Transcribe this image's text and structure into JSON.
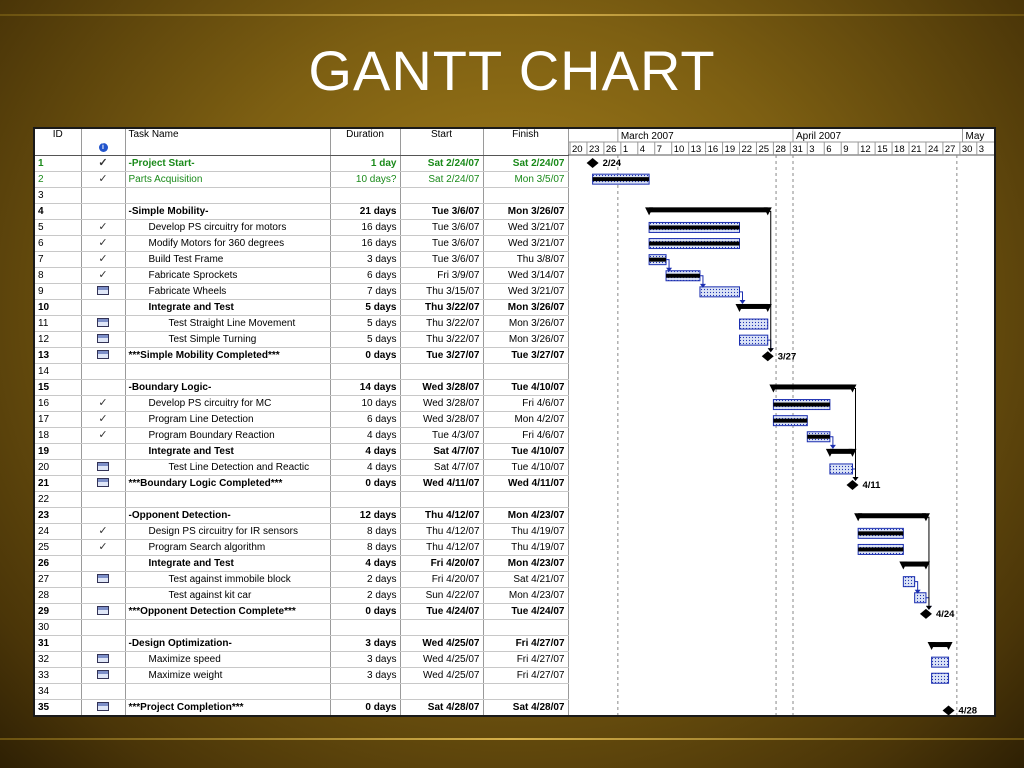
{
  "slide": {
    "title": "GANTT CHART"
  },
  "columns": {
    "id": "ID",
    "task": "Task Name",
    "duration": "Duration",
    "start": "Start",
    "finish": "Finish"
  },
  "timescale": {
    "months": [
      "March 2007",
      "April 2007",
      "May"
    ],
    "days": [
      "20",
      "23",
      "26",
      "1",
      "4",
      "7",
      "10",
      "13",
      "16",
      "19",
      "22",
      "25",
      "28",
      "31",
      "3",
      "6",
      "9",
      "12",
      "15",
      "18",
      "21",
      "24",
      "27",
      "30",
      "3"
    ]
  },
  "tasks": [
    {
      "id": "1",
      "indicator": "check",
      "name": "-Project Start-",
      "duration": "1 day",
      "start": "Sat 2/24/07",
      "finish": "Sat 2/24/07",
      "style": "summary-green",
      "indent": 0,
      "bar": {
        "type": "milestone",
        "start": "2/24",
        "end": "2/24",
        "label": "2/24"
      }
    },
    {
      "id": "2",
      "indicator": "check",
      "name": "Parts Acquisition",
      "duration": "10 days?",
      "start": "Sat 2/24/07",
      "finish": "Mon 3/5/07",
      "style": "green",
      "indent": 0,
      "bar": {
        "type": "task-done",
        "start": "2/24",
        "end": "3/6"
      }
    },
    {
      "id": "3",
      "indicator": "",
      "name": "",
      "duration": "",
      "start": "",
      "finish": "",
      "style": "",
      "indent": 0
    },
    {
      "id": "4",
      "indicator": "",
      "name": "-Simple Mobility-",
      "duration": "21 days",
      "start": "Tue 3/6/07",
      "finish": "Mon 3/26/07",
      "style": "summary",
      "indent": 0,
      "bar": {
        "type": "summary",
        "start": "3/6",
        "end": "3/27"
      }
    },
    {
      "id": "5",
      "indicator": "check",
      "name": "Develop PS circuitry for motors",
      "duration": "16 days",
      "start": "Tue 3/6/07",
      "finish": "Wed 3/21/07",
      "style": "",
      "indent": 1,
      "bar": {
        "type": "task-done",
        "start": "3/6",
        "end": "3/22"
      }
    },
    {
      "id": "6",
      "indicator": "check",
      "name": "Modify Motors for 360 degrees",
      "duration": "16 days",
      "start": "Tue 3/6/07",
      "finish": "Wed 3/21/07",
      "style": "",
      "indent": 1,
      "bar": {
        "type": "task-done",
        "start": "3/6",
        "end": "3/22"
      }
    },
    {
      "id": "7",
      "indicator": "check",
      "name": "Build Test Frame",
      "duration": "3 days",
      "start": "Tue 3/6/07",
      "finish": "Thu 3/8/07",
      "style": "",
      "indent": 1,
      "bar": {
        "type": "task-done",
        "start": "3/6",
        "end": "3/9"
      }
    },
    {
      "id": "8",
      "indicator": "check",
      "name": "Fabricate Sprockets",
      "duration": "6 days",
      "start": "Fri 3/9/07",
      "finish": "Wed 3/14/07",
      "style": "",
      "indent": 1,
      "bar": {
        "type": "task-done",
        "start": "3/9",
        "end": "3/15"
      }
    },
    {
      "id": "9",
      "indicator": "note",
      "name": "Fabricate Wheels",
      "duration": "7 days",
      "start": "Thu 3/15/07",
      "finish": "Wed 3/21/07",
      "style": "",
      "indent": 1,
      "bar": {
        "type": "task",
        "start": "3/15",
        "end": "3/22"
      }
    },
    {
      "id": "10",
      "indicator": "",
      "name": "Integrate and Test",
      "duration": "5 days",
      "start": "Thu 3/22/07",
      "finish": "Mon 3/26/07",
      "style": "summary",
      "indent": 1,
      "bar": {
        "type": "summary",
        "start": "3/22",
        "end": "3/27"
      }
    },
    {
      "id": "11",
      "indicator": "note",
      "name": "Test Straight Line Movement",
      "duration": "5 days",
      "start": "Thu 3/22/07",
      "finish": "Mon 3/26/07",
      "style": "",
      "indent": 2,
      "bar": {
        "type": "task",
        "start": "3/22",
        "end": "3/27"
      }
    },
    {
      "id": "12",
      "indicator": "note",
      "name": "Test Simple Turning",
      "duration": "5 days",
      "start": "Thu 3/22/07",
      "finish": "Mon 3/26/07",
      "style": "",
      "indent": 2,
      "bar": {
        "type": "task",
        "start": "3/22",
        "end": "3/27"
      }
    },
    {
      "id": "13",
      "indicator": "note",
      "name": "***Simple Mobility Completed***",
      "duration": "0 days",
      "start": "Tue 3/27/07",
      "finish": "Tue 3/27/07",
      "style": "summary",
      "indent": 0,
      "bar": {
        "type": "milestone",
        "start": "3/27",
        "end": "3/27",
        "label": "3/27"
      }
    },
    {
      "id": "14",
      "indicator": "",
      "name": "",
      "duration": "",
      "start": "",
      "finish": "",
      "style": "",
      "indent": 0
    },
    {
      "id": "15",
      "indicator": "",
      "name": "-Boundary Logic-",
      "duration": "14 days",
      "start": "Wed 3/28/07",
      "finish": "Tue 4/10/07",
      "style": "summary",
      "indent": 0,
      "bar": {
        "type": "summary",
        "start": "3/28",
        "end": "4/11"
      }
    },
    {
      "id": "16",
      "indicator": "check",
      "name": "Develop PS circuitry for MC",
      "duration": "10 days",
      "start": "Wed 3/28/07",
      "finish": "Fri 4/6/07",
      "style": "",
      "indent": 1,
      "bar": {
        "type": "task-done",
        "start": "3/28",
        "end": "4/7"
      }
    },
    {
      "id": "17",
      "indicator": "check",
      "name": "Program Line Detection",
      "duration": "6 days",
      "start": "Wed 3/28/07",
      "finish": "Mon 4/2/07",
      "style": "",
      "indent": 1,
      "bar": {
        "type": "task-done",
        "start": "3/28",
        "end": "4/3"
      }
    },
    {
      "id": "18",
      "indicator": "check",
      "name": "Program Boundary Reaction",
      "duration": "4 days",
      "start": "Tue 4/3/07",
      "finish": "Fri 4/6/07",
      "style": "",
      "indent": 1,
      "bar": {
        "type": "task-done",
        "start": "4/3",
        "end": "4/7"
      }
    },
    {
      "id": "19",
      "indicator": "",
      "name": "Integrate and Test",
      "duration": "4 days",
      "start": "Sat 4/7/07",
      "finish": "Tue 4/10/07",
      "style": "summary",
      "indent": 1,
      "bar": {
        "type": "summary",
        "start": "4/7",
        "end": "4/11"
      }
    },
    {
      "id": "20",
      "indicator": "note",
      "name": "Test Line Detection and Reactic",
      "duration": "4 days",
      "start": "Sat 4/7/07",
      "finish": "Tue 4/10/07",
      "style": "",
      "indent": 2,
      "bar": {
        "type": "task",
        "start": "4/7",
        "end": "4/11"
      }
    },
    {
      "id": "21",
      "indicator": "note",
      "name": "***Boundary Logic Completed***",
      "duration": "0 days",
      "start": "Wed 4/11/07",
      "finish": "Wed 4/11/07",
      "style": "summary",
      "indent": 0,
      "bar": {
        "type": "milestone",
        "start": "4/11",
        "end": "4/11",
        "label": "4/11"
      }
    },
    {
      "id": "22",
      "indicator": "",
      "name": "",
      "duration": "",
      "start": "",
      "finish": "",
      "style": "",
      "indent": 0
    },
    {
      "id": "23",
      "indicator": "",
      "name": "-Opponent Detection-",
      "duration": "12 days",
      "start": "Thu 4/12/07",
      "finish": "Mon 4/23/07",
      "style": "summary",
      "indent": 0,
      "bar": {
        "type": "summary",
        "start": "4/12",
        "end": "4/24"
      }
    },
    {
      "id": "24",
      "indicator": "check",
      "name": "Design PS circuitry for IR sensors",
      "duration": "8 days",
      "start": "Thu 4/12/07",
      "finish": "Thu 4/19/07",
      "style": "",
      "indent": 1,
      "bar": {
        "type": "task-done",
        "start": "4/12",
        "end": "4/20"
      }
    },
    {
      "id": "25",
      "indicator": "check",
      "name": "Program Search algorithm",
      "duration": "8 days",
      "start": "Thu 4/12/07",
      "finish": "Thu 4/19/07",
      "style": "",
      "indent": 1,
      "bar": {
        "type": "task-done",
        "start": "4/12",
        "end": "4/20"
      }
    },
    {
      "id": "26",
      "indicator": "",
      "name": "Integrate and Test",
      "duration": "4 days",
      "start": "Fri 4/20/07",
      "finish": "Mon 4/23/07",
      "style": "summary",
      "indent": 1,
      "bar": {
        "type": "summary",
        "start": "4/20",
        "end": "4/24"
      }
    },
    {
      "id": "27",
      "indicator": "note",
      "name": "Test against immobile block",
      "duration": "2 days",
      "start": "Fri 4/20/07",
      "finish": "Sat 4/21/07",
      "style": "",
      "indent": 2,
      "bar": {
        "type": "task",
        "start": "4/20",
        "end": "4/22"
      }
    },
    {
      "id": "28",
      "indicator": "",
      "name": "Test against kit car",
      "duration": "2 days",
      "start": "Sun 4/22/07",
      "finish": "Mon 4/23/07",
      "style": "",
      "indent": 2,
      "bar": {
        "type": "task",
        "start": "4/22",
        "end": "4/24"
      }
    },
    {
      "id": "29",
      "indicator": "note",
      "name": "***Opponent Detection Complete***",
      "duration": "0 days",
      "start": "Tue 4/24/07",
      "finish": "Tue 4/24/07",
      "style": "summary",
      "indent": 0,
      "bar": {
        "type": "milestone",
        "start": "4/24",
        "end": "4/24",
        "label": "4/24"
      }
    },
    {
      "id": "30",
      "indicator": "",
      "name": "",
      "duration": "",
      "start": "",
      "finish": "",
      "style": "",
      "indent": 0
    },
    {
      "id": "31",
      "indicator": "",
      "name": "-Design Optimization-",
      "duration": "3 days",
      "start": "Wed 4/25/07",
      "finish": "Fri 4/27/07",
      "style": "summary",
      "indent": 0,
      "bar": {
        "type": "summary",
        "start": "4/25",
        "end": "4/28"
      }
    },
    {
      "id": "32",
      "indicator": "note",
      "name": "Maximize speed",
      "duration": "3 days",
      "start": "Wed 4/25/07",
      "finish": "Fri 4/27/07",
      "style": "",
      "indent": 1,
      "bar": {
        "type": "task",
        "start": "4/25",
        "end": "4/28"
      }
    },
    {
      "id": "33",
      "indicator": "note",
      "name": "Maximize weight",
      "duration": "3 days",
      "start": "Wed 4/25/07",
      "finish": "Fri 4/27/07",
      "style": "",
      "indent": 1,
      "bar": {
        "type": "task",
        "start": "4/25",
        "end": "4/28"
      }
    },
    {
      "id": "34",
      "indicator": "",
      "name": "",
      "duration": "",
      "start": "",
      "finish": "",
      "style": "",
      "indent": 0
    },
    {
      "id": "35",
      "indicator": "note",
      "name": "***Project Completion***",
      "duration": "0 days",
      "start": "Sat 4/28/07",
      "finish": "Sat 4/28/07",
      "style": "summary",
      "indent": 0,
      "bar": {
        "type": "milestone",
        "start": "4/28",
        "end": "4/28",
        "label": "4/28"
      }
    }
  ],
  "colors": {
    "task_fill": "#dbe3f6",
    "task_border": "#1c2fb0",
    "done_fill": "#000000",
    "link": "#1c2fb0",
    "green_text": "#1a8a1a"
  }
}
